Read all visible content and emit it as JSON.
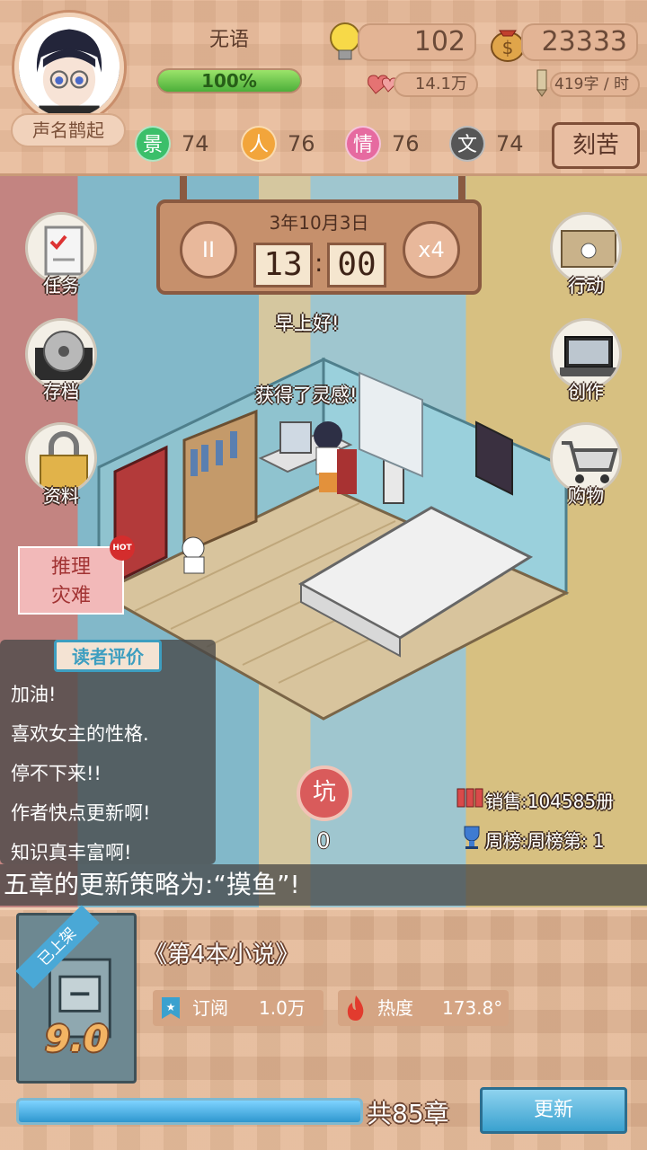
{
  "player": {
    "name": "无语",
    "rank": "声名鹊起",
    "energy_percent": 100,
    "energy_label": "100%"
  },
  "resources": {
    "inspiration": "102",
    "money": "23333",
    "fans": "14.1万",
    "speed": "419字 / 时"
  },
  "stats": [
    {
      "label": "景",
      "value": "74",
      "color": "#3bbf6a"
    },
    {
      "label": "人",
      "value": "76",
      "color": "#f2a53b"
    },
    {
      "label": "情",
      "value": "76",
      "color": "#e66aa0"
    },
    {
      "label": "文",
      "value": "74",
      "color": "#565656"
    }
  ],
  "kecku_button": "刻苦",
  "clock": {
    "date": "3年10月3日",
    "hour": "13",
    "minute": "00",
    "speed": "x4",
    "pause": "II"
  },
  "side_left": [
    {
      "label": "任务"
    },
    {
      "label": "存档"
    },
    {
      "label": "资料"
    }
  ],
  "side_right": [
    {
      "label": "行动"
    },
    {
      "label": "创作"
    },
    {
      "label": "购物"
    }
  ],
  "messages": {
    "greeting": "早上好!",
    "inspiration": "获得了灵感!"
  },
  "event": {
    "label_line1": "推理",
    "label_line2": "灾难",
    "badge": "HOT"
  },
  "comments": {
    "title": "读者评价",
    "items": [
      "加油!",
      "喜欢女主的性格.",
      "停不下来!!",
      "作者快点更新啊!",
      "知识真丰富啊!"
    ]
  },
  "pit": {
    "label": "坑",
    "count": "0"
  },
  "sales": "销售:104585册",
  "weekly_rank": "周榜:周榜第: 1",
  "banner": "五章的更新策略为:“摸鱼”!",
  "book": {
    "status": "已上架",
    "score": "9.0",
    "title": "《第4本小说》",
    "subscribe_label": "订阅",
    "subscribe_value": "1.0万",
    "heat_label": "热度",
    "heat_value": "173.8°",
    "progress_percent": 100,
    "chapters": "共85章",
    "update_button": "更新"
  }
}
